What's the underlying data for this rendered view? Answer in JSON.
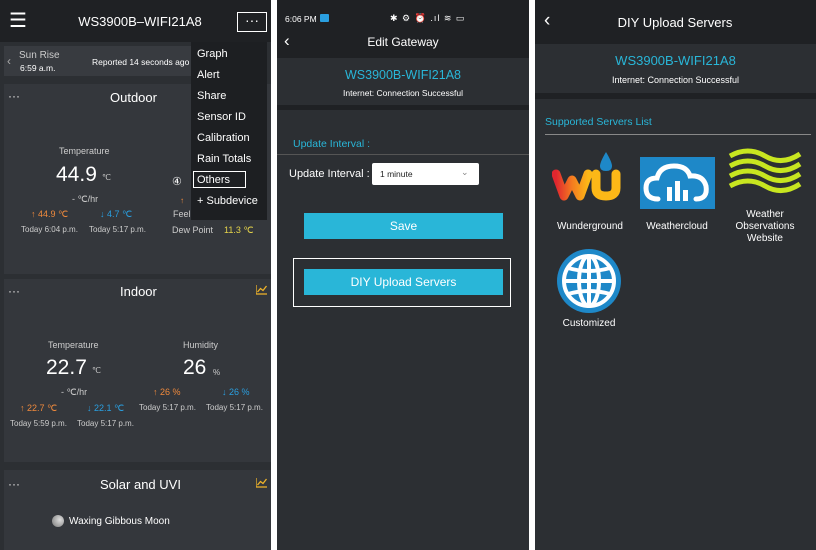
{
  "colors": {
    "accent": "#29b6d8",
    "bg": "#2c2f33",
    "dark": "#1f2124",
    "orange": "#f08a3c",
    "blue": "#2a9fe0",
    "yellow": "#e6d44a",
    "gold": "#f0b429"
  },
  "p1": {
    "title": "WS3900B–WIFI21A8",
    "sunrise_label": "Sun Rise",
    "sunrise_time": "6:59 a.m.",
    "reported": "Reported 14 seconds ago",
    "menu": [
      "Graph",
      "Alert",
      "Share",
      "Sensor ID",
      "Calibration",
      "Rain Totals",
      "Others",
      "+ Subdevice"
    ],
    "marker": "④",
    "outdoor": {
      "title": "Outdoor",
      "temp_label": "Temperature",
      "temp": "44.9",
      "unit": "℃",
      "rate": "- ℃/hr",
      "high": "↑ 44.9 ℃",
      "low": "↓ 4.7 ℃",
      "high_time": "Today 6:04 p.m.",
      "low_time": "Today 5:17 p.m.",
      "feels": "Feel",
      "dew_label": "Dew Point",
      "dew_value": "11.3 ℃"
    },
    "indoor": {
      "title": "Indoor",
      "temp_label": "Temperature",
      "temp": "22.7",
      "unit": "℃",
      "rate": "- ℃/hr",
      "high": "↑ 22.7 ℃",
      "low": "↓ 22.1 ℃",
      "high_time": "Today 5:59 p.m.",
      "low_time": "Today 5:17 p.m.",
      "hum_label": "Humidity",
      "hum": "26",
      "hum_unit": "%",
      "hum_high": "↑ 26 %",
      "hum_low": "↓ 26 %",
      "hum_high_time": "Today 5:17 p.m.",
      "hum_low_time": "Today 5:17 p.m."
    },
    "solar": {
      "title": "Solar and UVI",
      "moon": "Waxing Gibbous Moon"
    }
  },
  "p2": {
    "time": "6:06 PM",
    "status_icons": "✱ ⚙ ⏰ .ıl ≋ ▭",
    "title": "Edit Gateway",
    "device": "WS3900B-WIFI21A8",
    "internet": "Internet: Connection Successful",
    "section": "Update Interval :",
    "interval_label": "Update Interval :",
    "interval_value": "1 minute",
    "save": "Save",
    "diy": "DIY Upload Servers"
  },
  "p3": {
    "title": "DIY Upload Servers",
    "device": "WS3900B-WIFI21A8",
    "internet": "Internet: Connection Successful",
    "list_title": "Supported Servers List",
    "servers": [
      "Wunderground",
      "Weathercloud",
      "Weather Observations Website",
      "Customized"
    ]
  }
}
